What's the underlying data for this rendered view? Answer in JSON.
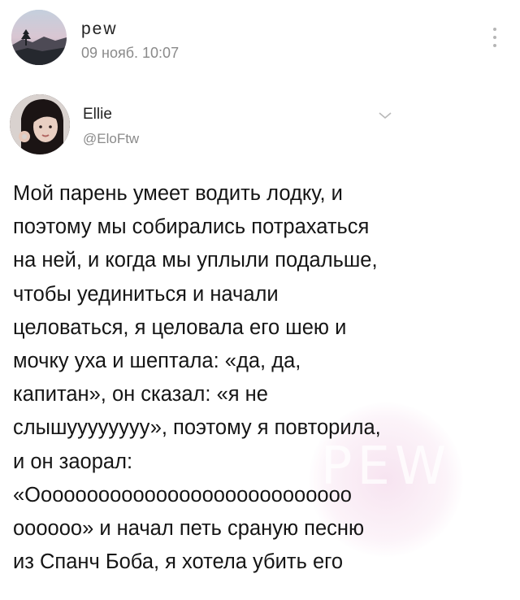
{
  "post": {
    "author": "pew",
    "date": "09 нояб. 10:07",
    "avatar_icon": "landscape-avatar-icon",
    "menu_icon": "vertical-dots-icon"
  },
  "tweet": {
    "name": "Ellie",
    "handle": "@EloFtw",
    "avatar_icon": "user-photo-avatar-icon",
    "chevron_icon": "chevron-down-icon",
    "lines": [
      "Мой парень умеет водить лодку, и",
      "поэтому мы собирались потрахаться",
      "на ней, и когда мы уплыли подальше,",
      "чтобы уединиться и начали",
      "целоваться, я целовала его шею и",
      "мочку уха и шептала: «да, да,",
      "капитан», он сказал: «я не",
      "слышуууууууу», поэтому я повторила,",
      "и он заорал:",
      "«Оооооооооооооооооооооооооооо",
      "оооооо» и начал петь сраную песню",
      "из Спанч Боба, я хотела убить его"
    ],
    "watermark": "PEW"
  },
  "colors": {
    "background": "#ffffff",
    "text": "#151515",
    "muted": "#8a8a8a",
    "watermark_tint": "#f0cde4"
  }
}
